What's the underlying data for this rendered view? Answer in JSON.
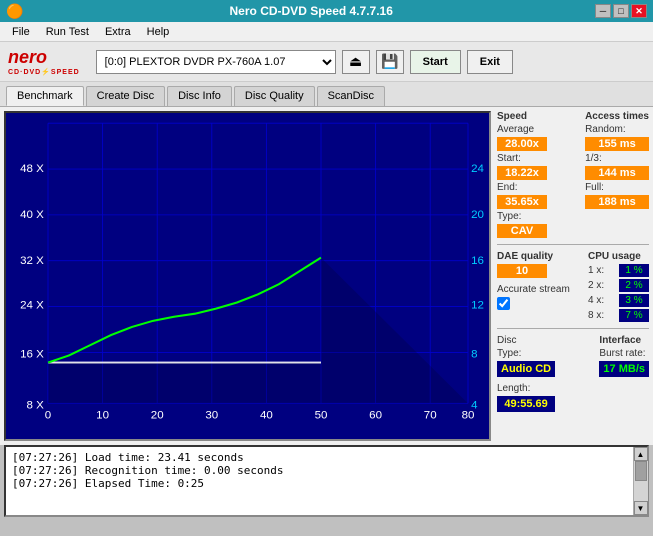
{
  "titlebar": {
    "title": "Nero CD-DVD Speed 4.7.7.16",
    "icon": "🔴",
    "min": "─",
    "max": "□",
    "close": "✕"
  },
  "menu": {
    "items": [
      "File",
      "Run Test",
      "Extra",
      "Help"
    ]
  },
  "toolbar": {
    "drive_value": "[0:0]  PLEXTOR DVDR  PX-760A 1.07",
    "start_label": "Start",
    "exit_label": "Exit"
  },
  "tabs": [
    {
      "label": "Benchmark",
      "active": true
    },
    {
      "label": "Create Disc",
      "active": false
    },
    {
      "label": "Disc Info",
      "active": false
    },
    {
      "label": "Disc Quality",
      "active": false
    },
    {
      "label": "ScanDisc",
      "active": false
    }
  ],
  "stats": {
    "speed": {
      "title": "Speed",
      "average_label": "Average",
      "average_value": "28.00x",
      "start_label": "Start:",
      "start_value": "18.22x",
      "end_label": "End:",
      "end_value": "35.65x",
      "type_label": "Type:",
      "type_value": "CAV"
    },
    "access": {
      "title": "Access times",
      "random_label": "Random:",
      "random_value": "155 ms",
      "onethird_label": "1/3:",
      "onethird_value": "144 ms",
      "full_label": "Full:",
      "full_value": "188 ms"
    },
    "dae": {
      "title": "DAE quality",
      "value": "10",
      "accurate_label": "Accurate stream"
    },
    "cpu": {
      "title": "CPU usage",
      "rows": [
        {
          "label": "1 x:",
          "value": "1 %"
        },
        {
          "label": "2 x:",
          "value": "2 %"
        },
        {
          "label": "4 x:",
          "value": "3 %"
        },
        {
          "label": "8 x:",
          "value": "7 %"
        }
      ]
    },
    "disc": {
      "type_label": "Disc",
      "type_sublabel": "Type:",
      "type_value": "Audio CD",
      "length_label": "Length:",
      "length_value": "49:55.69"
    },
    "interface": {
      "title": "Interface",
      "burst_label": "Burst rate:",
      "burst_value": "17 MB/s"
    }
  },
  "chart": {
    "x_labels": [
      "0",
      "10",
      "20",
      "30",
      "40",
      "50",
      "60",
      "70",
      "80"
    ],
    "y_left_labels": [
      "8 X",
      "16 X",
      "24 X",
      "32 X",
      "40 X",
      "48 X"
    ],
    "y_right_labels": [
      "4",
      "8",
      "12",
      "16",
      "20",
      "24"
    ]
  },
  "log": {
    "lines": [
      "[07:27:26]  Load time: 23.41 seconds",
      "[07:27:26]  Recognition time: 0.00 seconds",
      "[07:27:26]  Elapsed Time: 0:25"
    ]
  }
}
